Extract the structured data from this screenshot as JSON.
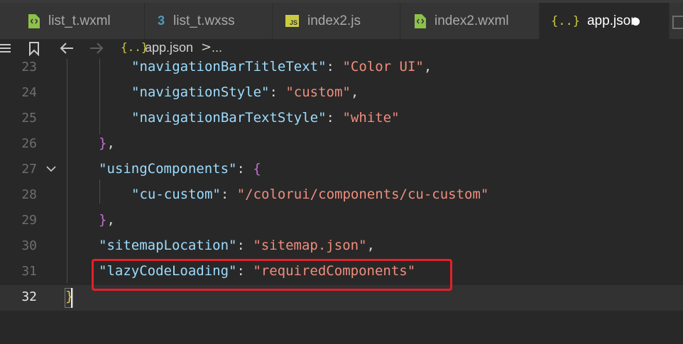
{
  "tabs": [
    {
      "label": "list_t.wxml",
      "icon": "wxml-file-icon",
      "active": false
    },
    {
      "label": "list_t.wxss",
      "icon": "css-file-icon",
      "active": false
    },
    {
      "label": "index2.js",
      "icon": "js-file-icon",
      "active": false
    },
    {
      "label": "index2.wxml",
      "icon": "wxml-file-icon",
      "active": false
    },
    {
      "label": "app.json",
      "icon": "json-file-icon",
      "active": true,
      "dirty": true
    }
  ],
  "icons": {
    "json_glyph": "{..}",
    "js_glyph": "JS",
    "css_glyph": "3"
  },
  "breadcrumb": {
    "file": "app.json",
    "separator": ">",
    "more": "..."
  },
  "code_lines": [
    {
      "number": "23",
      "key": "\"navigationBarTitleText\"",
      "colon": ": ",
      "value": "\"Color UI\"",
      "tail": ","
    },
    {
      "number": "24",
      "key": "\"navigationStyle\"",
      "colon": ": ",
      "value": "\"custom\"",
      "tail": ","
    },
    {
      "number": "25",
      "key": "\"navigationBarTextStyle\"",
      "colon": ": ",
      "value": "\"white\"",
      "tail": ""
    },
    {
      "number": "26",
      "close": "}",
      "tail": ","
    },
    {
      "number": "27",
      "key": "\"usingComponents\"",
      "colon": ": ",
      "open": "{"
    },
    {
      "number": "28",
      "key": "\"cu-custom\"",
      "colon": ": ",
      "value": "\"/colorui/components/cu-custom\"",
      "tail": ""
    },
    {
      "number": "29",
      "close": "}",
      "tail": ","
    },
    {
      "number": "30",
      "key": "\"sitemapLocation\"",
      "colon": ": ",
      "value": "\"sitemap.json\"",
      "tail": ","
    },
    {
      "number": "31",
      "key": "\"lazyCodeLoading\"",
      "colon": ": ",
      "value": "\"requiredComponents\"",
      "tail": ""
    },
    {
      "number": "32",
      "close": "}"
    }
  ],
  "colors": {
    "background": "#282828",
    "key": "#9cdcfe",
    "string": "#f08d7d",
    "bracket_level1": "#c56ed4",
    "bracket_level0": "#e6c34a",
    "highlight_box": "#e4202a",
    "json_icon": "#cbcb41",
    "wxml_icon": "#8dc149",
    "css_icon": "#519aba"
  }
}
